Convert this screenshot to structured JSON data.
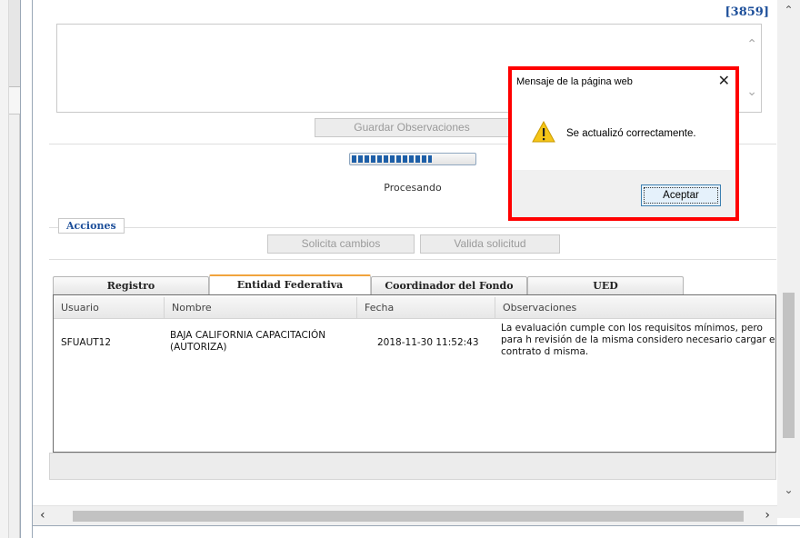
{
  "record_id": "[3859]",
  "observations": {
    "value": "",
    "save_button": "Guardar Observaciones"
  },
  "progress": {
    "label": "Procesando",
    "fraction": 0.65
  },
  "actions": {
    "legend": "Acciones",
    "request_changes": "Solicita cambios",
    "validate_request": "Valida solicitud"
  },
  "tabs": [
    {
      "label": "Registro",
      "active": false
    },
    {
      "label": "Entidad Federativa",
      "active": true
    },
    {
      "label": "Coordinador del Fondo",
      "active": false
    },
    {
      "label": "UED",
      "active": false
    }
  ],
  "grid": {
    "columns": [
      "Usuario",
      "Nombre",
      "Fecha",
      "Observaciones"
    ],
    "rows": [
      {
        "usuario": "SFUAUT12",
        "nombre": "BAJA CALIFORNIA CAPACITACIÓN (AUTORIZA)",
        "fecha": "2018-11-30 11:52:43",
        "observaciones": "La evaluación cumple con los requisitos mínimos, pero para h revisión de la misma considero necesario cargar el contrato d misma."
      }
    ]
  },
  "dialog": {
    "title": "Mensaje de la página web",
    "message": "Se actualizó correctamente.",
    "ok_button": "Aceptar",
    "highlight_color": "#ff0000"
  },
  "icons": {
    "close": "close-icon",
    "warning": "warning-icon",
    "scroll_up": "chevron-up-icon",
    "scroll_down": "chevron-down-icon",
    "scroll_left": "chevron-left-icon",
    "scroll_right": "chevron-right-icon"
  }
}
